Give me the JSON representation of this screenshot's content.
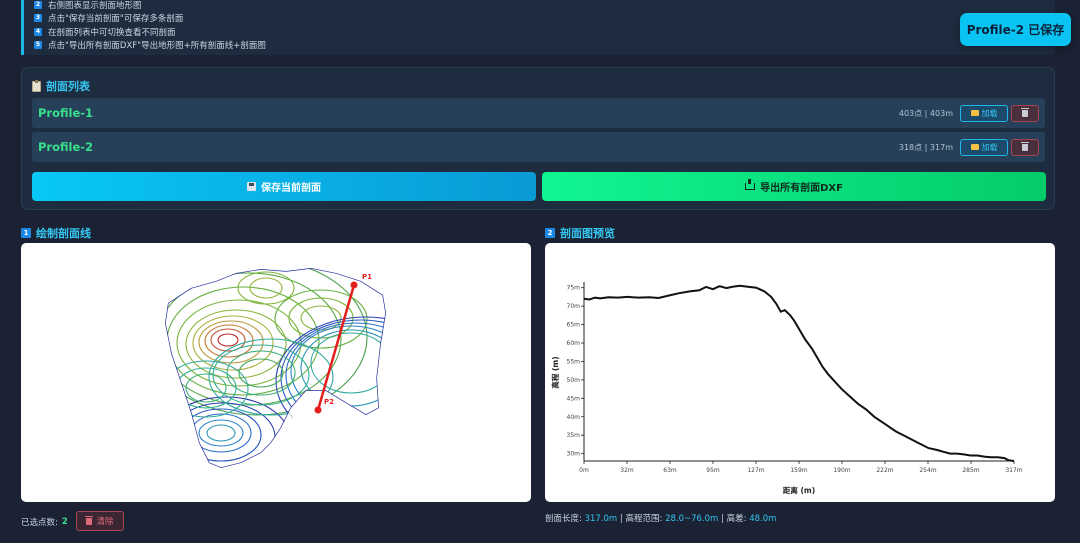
{
  "instructions": [
    {
      "num": "2",
      "text": "右侧图表显示剖面地形图"
    },
    {
      "num": "3",
      "text": "点击\"保存当前剖面\"可保存多条剖面"
    },
    {
      "num": "4",
      "text": "在剖面列表中可切换查看不同剖面"
    },
    {
      "num": "5",
      "text": "点击\"导出所有剖面DXF\"导出地形图+所有剖面线+剖面图"
    }
  ],
  "toast": "Profile-2 已保存",
  "profile_list": {
    "title": "剖面列表",
    "items": [
      {
        "name": "Profile-1",
        "meta": "403点 | 403m",
        "load_label": "加载"
      },
      {
        "name": "Profile-2",
        "meta": "318点 | 317m",
        "load_label": "加载"
      }
    ],
    "save_label": "保存当前剖面",
    "export_label": "导出所有剖面DXF"
  },
  "draw_section": {
    "num": "1",
    "title": "绘制剖面线",
    "p1_label": "P1",
    "p2_label": "P2"
  },
  "preview_section": {
    "num": "2",
    "title": "剖面图预览"
  },
  "status": {
    "selected_label": "已选点数:",
    "selected_count": "2",
    "clear_label": "清除"
  },
  "stats": {
    "length_label": "剖面长度:",
    "length_value": "317.0m",
    "range_label": "高程范围:",
    "range_value": "28.0~76.0m",
    "diff_label": "高差:",
    "diff_value": "48.0m"
  },
  "colors": {
    "accent": "#35c6f2",
    "green": "#39e08c",
    "danger": "#e06a78",
    "panel": "#1e2c40"
  },
  "chart_data": {
    "type": "line",
    "xlabel": "距离 (m)",
    "ylabel": "高程 (m)",
    "xlim": [
      0,
      317
    ],
    "ylim": [
      28,
      76
    ],
    "x_ticks": [
      "0m",
      "32m",
      "63m",
      "95m",
      "127m",
      "159m",
      "190m",
      "222m",
      "254m",
      "285m",
      "317m"
    ],
    "y_ticks": [
      "30m",
      "35m",
      "40m",
      "45m",
      "50m",
      "55m",
      "60m",
      "65m",
      "70m",
      "75m"
    ],
    "series": [
      {
        "x": [
          0,
          4,
          8,
          12,
          18,
          25,
          32,
          40,
          48,
          55,
          63,
          70,
          78,
          85,
          90,
          95,
          100,
          105,
          110,
          115,
          120,
          127,
          133,
          138,
          142,
          145,
          148,
          152,
          155,
          159,
          163,
          168,
          172,
          176,
          180,
          185,
          190,
          196,
          202,
          208,
          214,
          222,
          230,
          238,
          246,
          254,
          260,
          265,
          270,
          275,
          280,
          285,
          290,
          295,
          300,
          305,
          310,
          313,
          317
        ],
        "y": [
          72.0,
          71.8,
          72.3,
          72.1,
          72.4,
          72.3,
          72.5,
          72.3,
          72.4,
          72.2,
          72.9,
          73.5,
          74.0,
          74.3,
          75.2,
          74.6,
          75.4,
          74.9,
          75.3,
          75.5,
          75.3,
          75.0,
          74.0,
          72.5,
          70.5,
          68.5,
          68.9,
          67.5,
          66.0,
          63.5,
          61.0,
          58.5,
          56.0,
          53.5,
          51.5,
          49.5,
          47.5,
          45.5,
          43.5,
          42.0,
          40.0,
          38.0,
          36.0,
          34.5,
          33.0,
          31.5,
          31.0,
          30.5,
          30.0,
          30.0,
          29.8,
          29.5,
          29.5,
          29.2,
          29.0,
          29.0,
          28.8,
          28.2,
          28.0
        ]
      }
    ],
    "grid": false
  }
}
